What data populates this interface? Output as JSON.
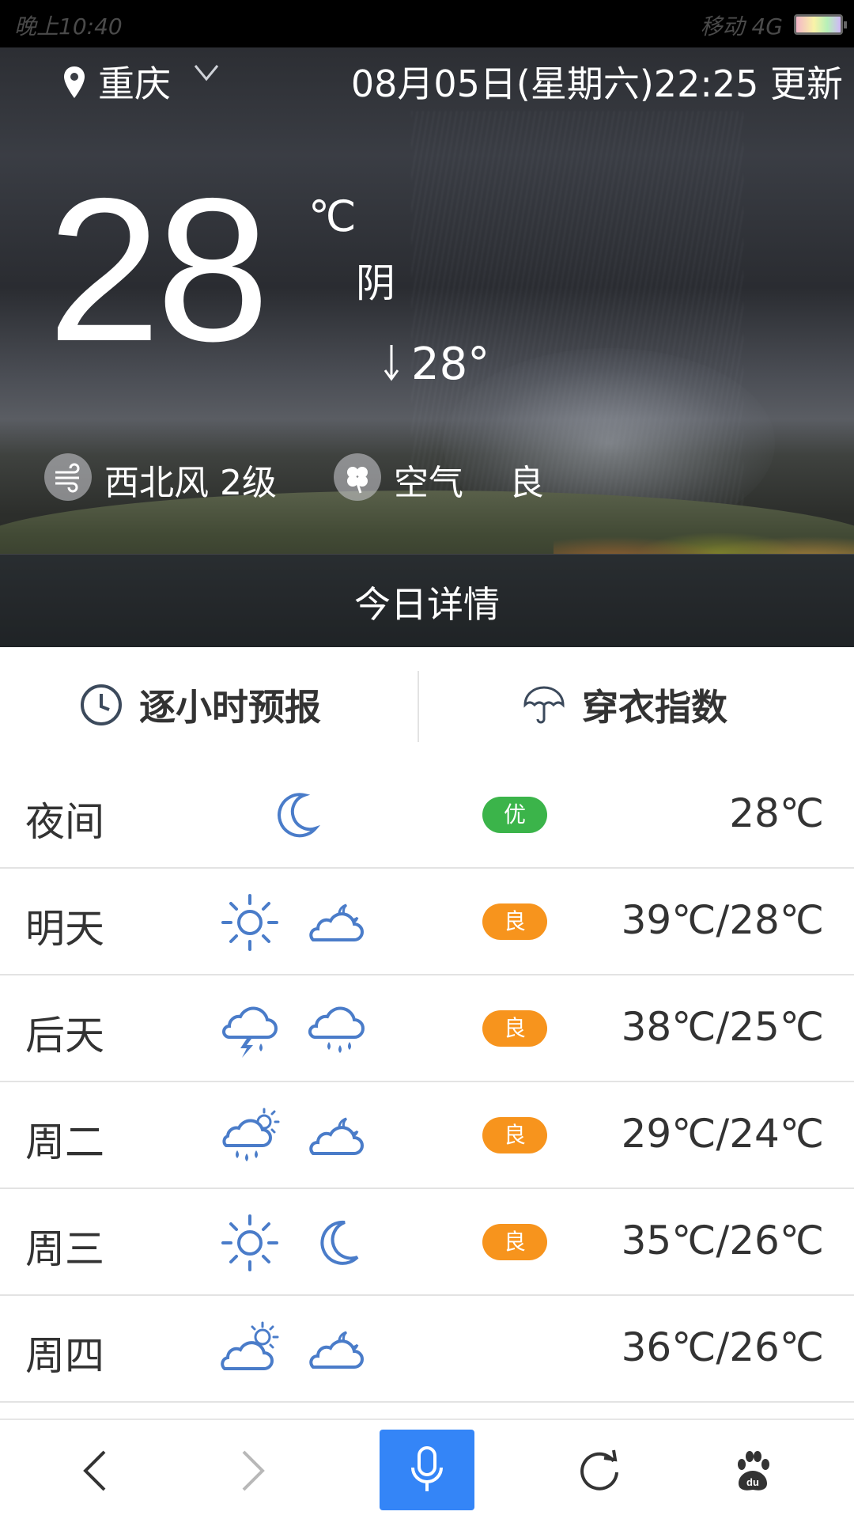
{
  "status_bar": {
    "time": "晚上10:40",
    "carrier": "移动 4G"
  },
  "header": {
    "location": "重庆",
    "update_time": "08月05日(星期六)22:25 更新"
  },
  "current": {
    "temperature": "28",
    "unit": "℃",
    "condition": "阴",
    "low_temperature": "28°",
    "wind": "西北风 2级",
    "air_label": "空气",
    "air_quality": "良"
  },
  "today_detail": "今日详情",
  "tabs": {
    "hourly": "逐小时预报",
    "clothing": "穿衣指数"
  },
  "forecast": [
    {
      "day": "夜间",
      "icons": [
        "moon-icon"
      ],
      "aqi": "优",
      "aqi_color": "#3bb44a",
      "temp": "28℃"
    },
    {
      "day": "明天",
      "icons": [
        "sun-icon",
        "cloudy-night-icon"
      ],
      "aqi": "良",
      "aqi_color": "#f7941d",
      "temp": "39℃/28℃"
    },
    {
      "day": "后天",
      "icons": [
        "thunderstorm-icon",
        "rain-icon"
      ],
      "aqi": "良",
      "aqi_color": "#f7941d",
      "temp": "38℃/25℃"
    },
    {
      "day": "周二",
      "icons": [
        "sun-shower-icon",
        "cloudy-night-icon"
      ],
      "aqi": "良",
      "aqi_color": "#f7941d",
      "temp": "29℃/24℃"
    },
    {
      "day": "周三",
      "icons": [
        "sun-icon",
        "moon-icon"
      ],
      "aqi": "良",
      "aqi_color": "#f7941d",
      "temp": "35℃/26℃"
    },
    {
      "day": "周四",
      "icons": [
        "partly-cloudy-day-icon",
        "cloudy-night-icon"
      ],
      "aqi": "",
      "aqi_color": "",
      "temp": "36℃/26℃"
    }
  ],
  "colors": {
    "icon_blue": "#4a7cc9",
    "voice_blue": "#3485f7",
    "aqi_good": "#3bb44a",
    "aqi_fair": "#f7941d"
  }
}
